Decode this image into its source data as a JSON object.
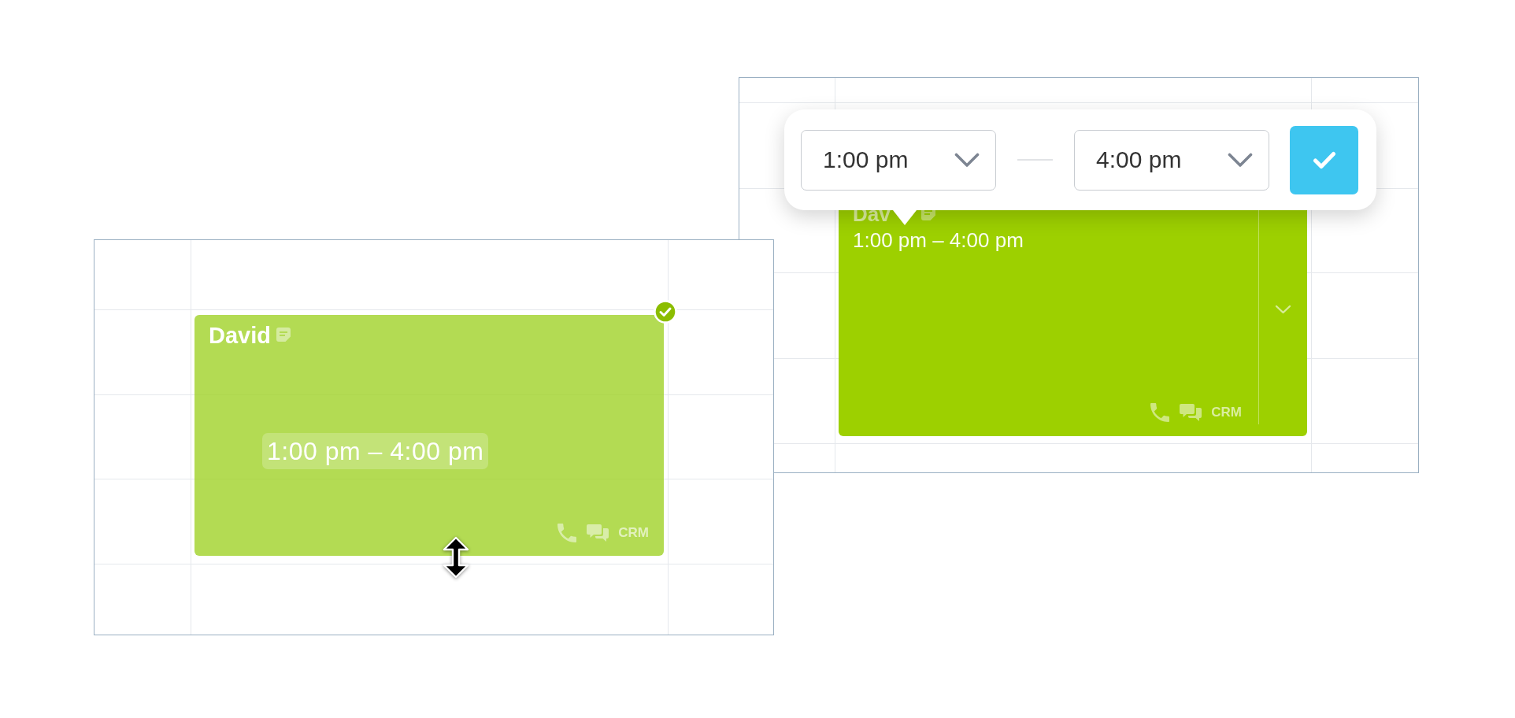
{
  "panels": [
    {
      "kind": "resize",
      "event": {
        "title": "David",
        "time": "1:00 pm – 4:00 pm",
        "confirmed": true,
        "tag": "CRM"
      }
    },
    {
      "kind": "edit",
      "event": {
        "title": "Dav",
        "time": "1:00 pm – 4:00 pm",
        "confirmed": false,
        "tag": "CRM"
      },
      "popover": {
        "start": "1:00 pm",
        "end": "4:00 pm"
      }
    }
  ]
}
